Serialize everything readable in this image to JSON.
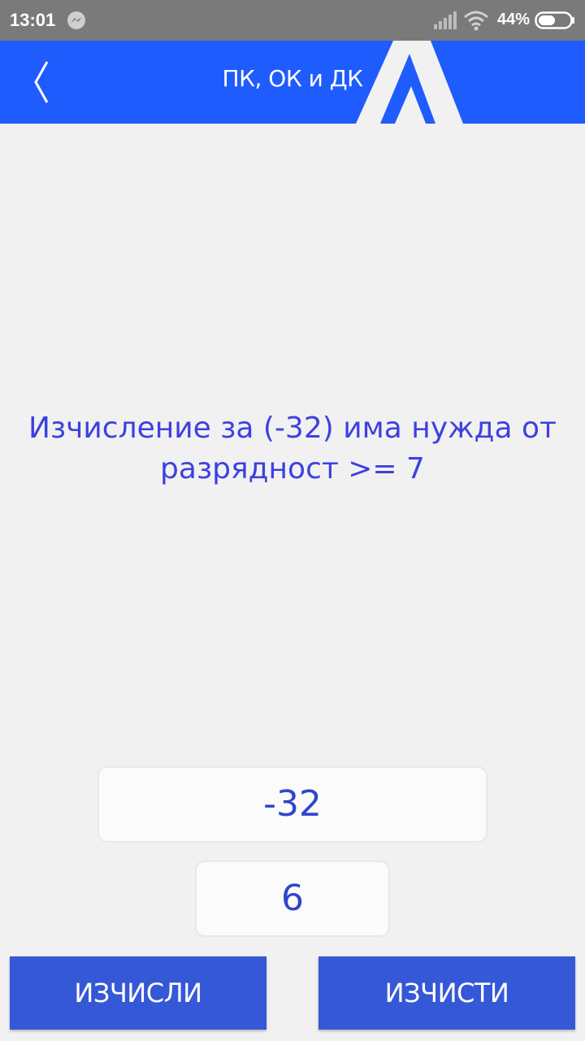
{
  "status_bar": {
    "time": "13:01",
    "battery": "44%",
    "icons": [
      "messenger-icon",
      "signal-icon",
      "wifi-icon",
      "battery-icon"
    ]
  },
  "app_bar": {
    "title": "ПК, ОК и ДК",
    "back_icon": "chevron-left-icon",
    "logo": "A",
    "background_color": "#1f5cfe"
  },
  "main": {
    "message": "Изчисление за (-32) има нужда от разрядност >= 7",
    "message_color": "#3d41e0",
    "value_input": "-32",
    "bits_input": "6"
  },
  "buttons": {
    "calculate": "ИЗЧИСЛИ",
    "clear": "ИЗЧИСТИ",
    "color": "#3558d6"
  }
}
